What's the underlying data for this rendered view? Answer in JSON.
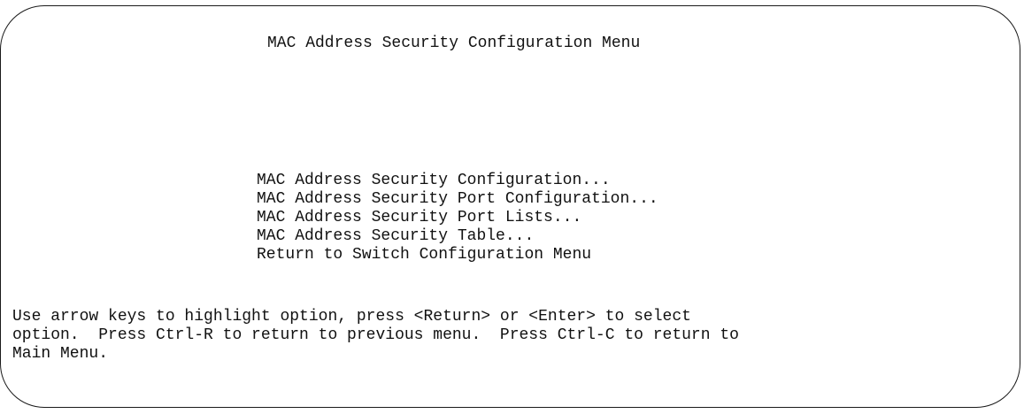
{
  "title": "MAC Address Security Configuration Menu",
  "menu": {
    "items": [
      {
        "label": "MAC Address Security Configuration..."
      },
      {
        "label": "MAC Address Security Port Configuration..."
      },
      {
        "label": "MAC Address Security Port Lists..."
      },
      {
        "label": "MAC Address Security Table..."
      },
      {
        "label": "Return to Switch Configuration Menu"
      }
    ]
  },
  "help": {
    "lines": [
      "Use arrow keys to highlight option, press <Return> or <Enter> to select",
      "option.  Press Ctrl-R to return to previous menu.  Press Ctrl-C to return to",
      "Main Menu."
    ]
  }
}
